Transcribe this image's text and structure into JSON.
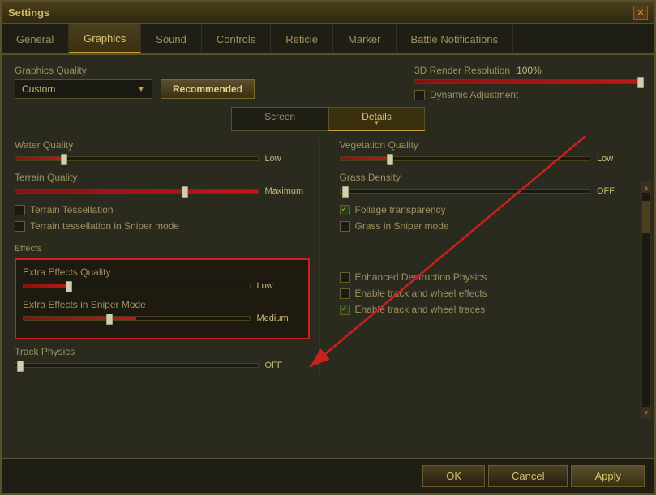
{
  "window": {
    "title": "Settings"
  },
  "tabs": [
    {
      "id": "general",
      "label": "General",
      "active": false
    },
    {
      "id": "graphics",
      "label": "Graphics",
      "active": true
    },
    {
      "id": "sound",
      "label": "Sound",
      "active": false
    },
    {
      "id": "controls",
      "label": "Controls",
      "active": false
    },
    {
      "id": "reticle",
      "label": "Reticle",
      "active": false
    },
    {
      "id": "marker",
      "label": "Marker",
      "active": false
    },
    {
      "id": "battle-notifications",
      "label": "Battle Notifications",
      "active": false
    }
  ],
  "graphics": {
    "quality_label": "Graphics Quality",
    "quality_value": "Custom",
    "recommended_btn": "Recommended",
    "render_label": "3D Render Resolution",
    "render_percent": "100%",
    "dynamic_adjustment_label": "Dynamic Adjustment",
    "dynamic_adjustment_checked": false,
    "screen_tab": "Screen",
    "details_tab": "Details",
    "water_quality_label": "Water Quality",
    "water_quality_value": "Low",
    "water_quality_pct": 20,
    "terrain_quality_label": "Terrain Quality",
    "terrain_quality_value": "Maximum",
    "terrain_quality_pct": 100,
    "terrain_tessellation_label": "Terrain Tessellation",
    "terrain_tessellation_checked": false,
    "terrain_tessellation_sniper_label": "Terrain tessellation in Sniper mode",
    "terrain_tessellation_sniper_checked": false,
    "vegetation_quality_label": "Vegetation Quality",
    "vegetation_quality_value": "Low",
    "vegetation_quality_pct": 20,
    "grass_density_label": "Grass Density",
    "grass_density_value": "OFF",
    "grass_density_pct": 0,
    "foliage_transparency_label": "Foliage transparency",
    "foliage_transparency_checked": true,
    "grass_sniper_label": "Grass in Sniper mode",
    "grass_sniper_checked": false,
    "effects_title": "Effects",
    "extra_effects_label": "Extra Effects Quality",
    "extra_effects_value": "Low",
    "extra_effects_pct": 20,
    "extra_effects_sniper_label": "Extra Effects in Sniper Mode",
    "extra_effects_sniper_value": "Medium",
    "extra_effects_sniper_pct": 50,
    "track_physics_label": "Track Physics",
    "track_physics_value": "OFF",
    "track_physics_pct": 0,
    "enhanced_destruction_label": "Enhanced Destruction Physics",
    "enhanced_destruction_checked": false,
    "track_wheel_effects_label": "Enable track and wheel effects",
    "track_wheel_effects_checked": false,
    "track_wheel_traces_label": "Enable track and wheel traces",
    "track_wheel_traces_checked": true
  },
  "footer": {
    "ok_label": "OK",
    "cancel_label": "Cancel",
    "apply_label": "Apply"
  }
}
